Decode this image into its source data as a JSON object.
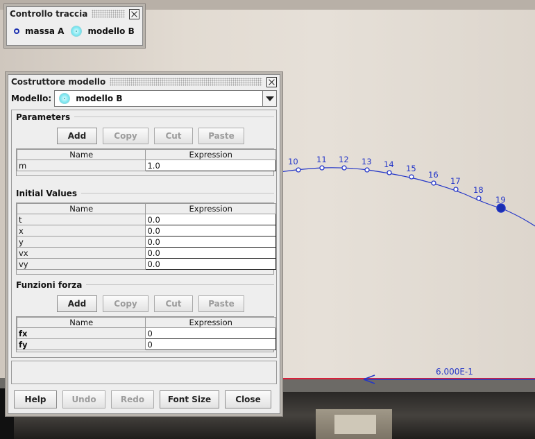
{
  "scene": {
    "points": [
      {
        "label": "10"
      },
      {
        "label": "11"
      },
      {
        "label": "12"
      },
      {
        "label": "13"
      },
      {
        "label": "14"
      },
      {
        "label": "15"
      },
      {
        "label": "16"
      },
      {
        "label": "17"
      },
      {
        "label": "18"
      },
      {
        "label": "19"
      }
    ],
    "vector_label": "6.000E-1",
    "colors": {
      "trace": "#2436c8",
      "axis": "#d8203a",
      "highlight": "#1a2fb0"
    }
  },
  "track_control": {
    "title": "Controllo traccia",
    "items": [
      {
        "label": "massa A",
        "icon": "ring-icon"
      },
      {
        "label": "modello B",
        "icon": "cyan-dot-icon"
      }
    ]
  },
  "model_builder": {
    "title": "Costruttore modello",
    "model_label": "Modello:",
    "model_value": "modello B",
    "parameters": {
      "title": "Parameters",
      "buttons": {
        "add": "Add",
        "copy": "Copy",
        "cut": "Cut",
        "paste": "Paste"
      },
      "columns": [
        "Name",
        "Expression"
      ],
      "rows": [
        {
          "name": "m",
          "expr": "1.0"
        }
      ]
    },
    "initial_values": {
      "title": "Initial Values",
      "columns": [
        "Name",
        "Expression"
      ],
      "rows": [
        {
          "name": "t",
          "expr": "0.0"
        },
        {
          "name": "x",
          "expr": "0.0"
        },
        {
          "name": "y",
          "expr": "0.0"
        },
        {
          "name": "vx",
          "expr": "0.0"
        },
        {
          "name": "vy",
          "expr": "0.0"
        }
      ]
    },
    "forces": {
      "title": "Funzioni forza",
      "buttons": {
        "add": "Add",
        "copy": "Copy",
        "cut": "Cut",
        "paste": "Paste"
      },
      "columns": [
        "Name",
        "Expression"
      ],
      "rows": [
        {
          "name": "fx",
          "expr": "0"
        },
        {
          "name": "fy",
          "expr": "0"
        }
      ]
    },
    "footer": {
      "help": "Help",
      "undo": "Undo",
      "redo": "Redo",
      "font_size": "Font Size",
      "close": "Close"
    }
  }
}
